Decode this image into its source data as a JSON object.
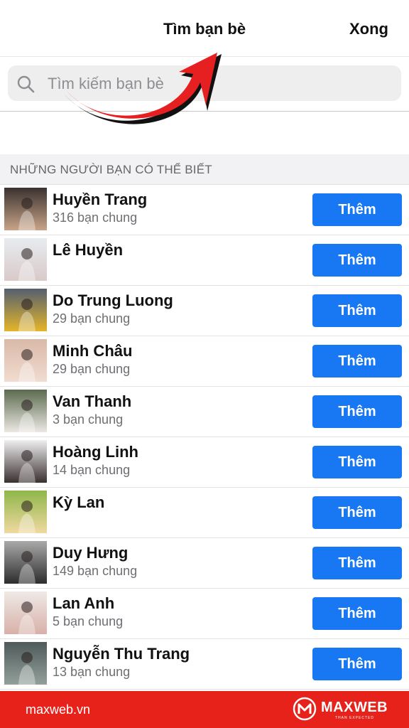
{
  "header": {
    "title": "Tìm bạn bè",
    "done_label": "Xong"
  },
  "search": {
    "placeholder": "Tìm kiếm bạn bè"
  },
  "section": {
    "label": "NHỮNG NGƯỜI BẠN CÓ THỂ BIẾT"
  },
  "add_label": "Thêm",
  "suggestions": [
    {
      "name": "Huyền Trang",
      "mutual": "316 bạn chung",
      "colors": [
        "#3a3230",
        "#c9a488"
      ]
    },
    {
      "name": "Lê Huyền",
      "mutual": "",
      "colors": [
        "#e7ecef",
        "#d9c9c9"
      ]
    },
    {
      "name": "Do Trung Luong",
      "mutual": "29 bạn chung",
      "colors": [
        "#556070",
        "#e5b52a"
      ]
    },
    {
      "name": "Minh Châu",
      "mutual": "29 bạn chung",
      "colors": [
        "#d9b9a8",
        "#f1dcd0"
      ]
    },
    {
      "name": "Van Thanh",
      "mutual": "3 bạn chung",
      "colors": [
        "#5b6b4e",
        "#ece8e4"
      ]
    },
    {
      "name": "Hoàng Linh",
      "mutual": "14 bạn chung",
      "colors": [
        "#efefef",
        "#3a3030"
      ]
    },
    {
      "name": "Kỳ Lan",
      "mutual": "",
      "colors": [
        "#8fb64a",
        "#f0d9a0"
      ]
    },
    {
      "name": "Duy Hưng",
      "mutual": "149 bạn chung",
      "colors": [
        "#a9a9a9",
        "#2d2d2d"
      ]
    },
    {
      "name": "Lan Anh",
      "mutual": "5 bạn chung",
      "colors": [
        "#efe9e6",
        "#d8b0a8"
      ]
    },
    {
      "name": "Nguyễn Thu Trang",
      "mutual": "13 bạn chung",
      "colors": [
        "#4e5a5a",
        "#93a09a"
      ]
    }
  ],
  "footer": {
    "site": "maxweb.vn",
    "brand": "MAXWEB",
    "tagline": "THAN EXPECTED"
  },
  "colors": {
    "accent": "#1877f2",
    "footer_bg": "#e6221b",
    "arrow": "#e62020"
  }
}
